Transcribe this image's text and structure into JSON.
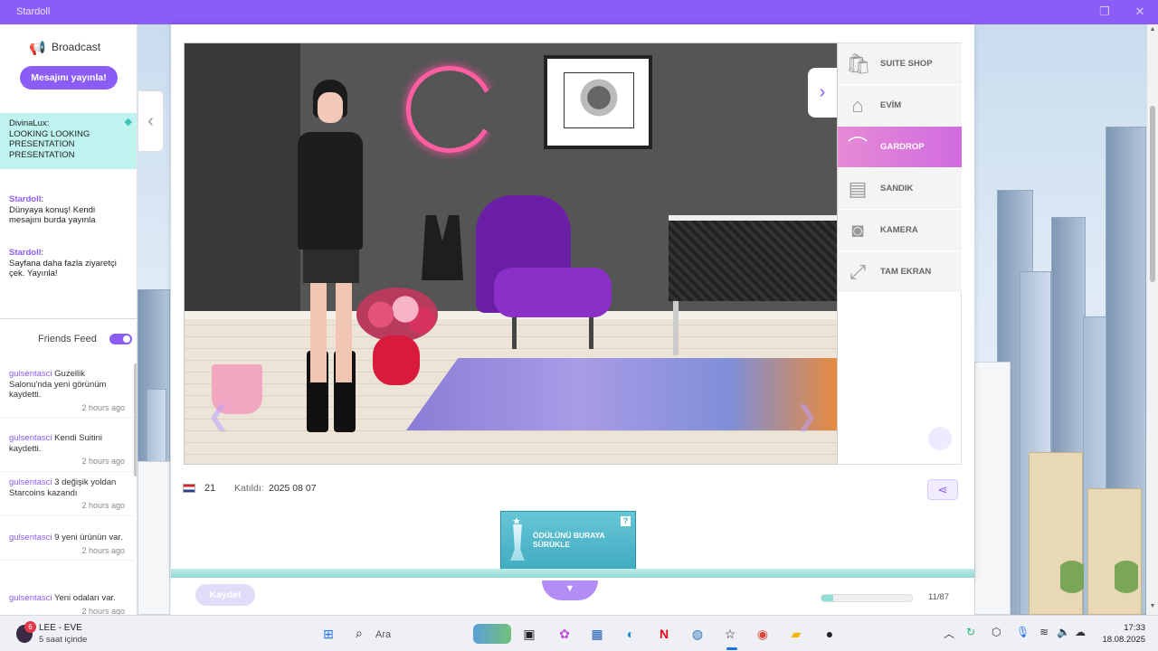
{
  "window": {
    "title": "Stardoll"
  },
  "sidebar": {
    "broadcast_label": "Broadcast",
    "publish_button": "Mesajını yayınla!",
    "messages": [
      {
        "user": "DivinaLux",
        "text": "LOOKING LOOKING PRESENTATION PRESENTATION"
      },
      {
        "user": "Stardoll",
        "text": "Dünyaya konuş! Kendi mesajını burda yayınla"
      },
      {
        "user": "Stardoll",
        "text": "Sayfana daha fazla ziyaretçi çek. Yayınla!"
      }
    ],
    "friends_feed_label": "Friends Feed",
    "feed": [
      {
        "user": "gulsentasci",
        "text": "Guzellik Salonu'nda yeni görünüm kaydetti.",
        "time": "2 hours ago"
      },
      {
        "user": "gulsentasci",
        "text": "Kendi Suitini kaydetti.",
        "time": "2 hours ago"
      },
      {
        "user": "gulsentasci",
        "text": "3 değişik yoldan Starcoins kazandı",
        "time": "2 hours ago"
      },
      {
        "user": "gulsentasci",
        "text": "9 yeni ürünün var.",
        "time": "2 hours ago"
      },
      {
        "user": "gulsentasci",
        "text": "Yeni odaları var.",
        "time": "2 hours ago"
      }
    ]
  },
  "menu": {
    "items": [
      {
        "label": "SUITE SHOP",
        "icon": "shopping-bag-icon"
      },
      {
        "label": "EVİM",
        "icon": "house-icon"
      },
      {
        "label": "GARDROP",
        "icon": "hanger-icon"
      },
      {
        "label": "SANDIK",
        "icon": "chest-icon"
      },
      {
        "label": "KAMERA",
        "icon": "camera-icon"
      },
      {
        "label": "TAM EKRAN",
        "icon": "fullscreen-icon"
      }
    ],
    "active": "GARDROP"
  },
  "profile": {
    "age": "21",
    "joined_label": "Katıldı:",
    "joined_date": "2025 08 07"
  },
  "award": {
    "text": "ÖDÜLÜNÜ BURAYA SÜRÜKLE",
    "help": "?"
  },
  "bottom": {
    "save_label": "Kaydet",
    "progress_text": "11/87",
    "progress_fraction": 0.13
  },
  "taskbar": {
    "notification_badge": "6",
    "notification_title": "LEE - EVE",
    "notification_sub": "5 saat içinde",
    "search_placeholder": "Ara",
    "time": "17:33",
    "date": "18.08.2025"
  },
  "colors": {
    "accent": "#8b5cf6",
    "active_menu": "#e78ad6",
    "highlight_message": "#bff3ef"
  }
}
